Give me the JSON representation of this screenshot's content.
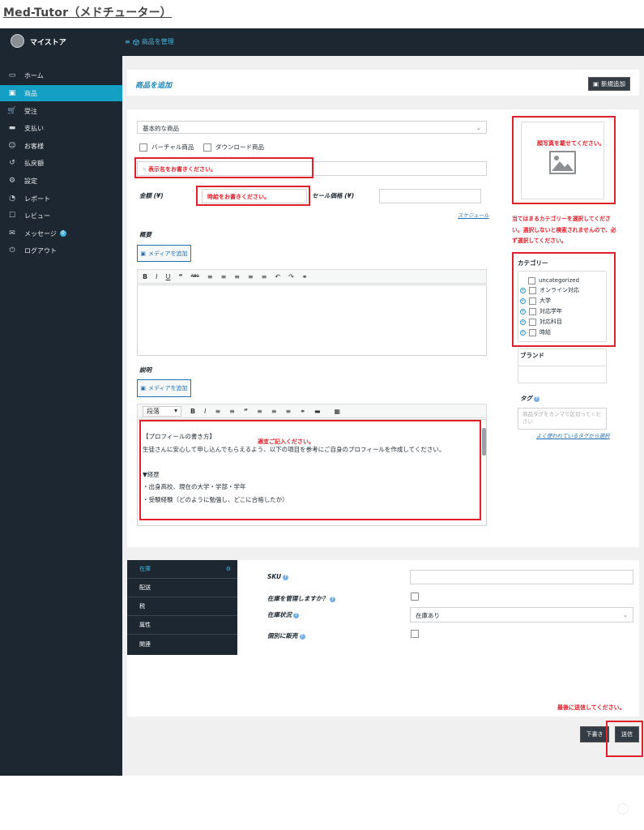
{
  "doc_title": "Med-Tutor（メドチューター）",
  "app": {
    "store_name": "マイストア",
    "breadcrumb": "商品を管理"
  },
  "sidebar": {
    "items": [
      {
        "label": "ホーム",
        "icon": "monitor-icon",
        "active": false
      },
      {
        "label": "商品",
        "icon": "box-icon",
        "active": true
      },
      {
        "label": "受注",
        "icon": "cart-icon",
        "active": false
      },
      {
        "label": "支払い",
        "icon": "card-icon",
        "active": false
      },
      {
        "label": "お客様",
        "icon": "user-icon",
        "active": false
      },
      {
        "label": "払戻額",
        "icon": "refund-icon",
        "active": false
      },
      {
        "label": "設定",
        "icon": "gear-icon",
        "active": false
      },
      {
        "label": "レポート",
        "icon": "chart-icon",
        "active": false
      },
      {
        "label": "レビュー",
        "icon": "comment-icon",
        "active": false
      },
      {
        "label": "メッセージ",
        "icon": "chat-icon",
        "active": false,
        "badge": "0"
      },
      {
        "label": "ログアウト",
        "icon": "power-icon",
        "active": false
      }
    ]
  },
  "header": {
    "title": "商品を追加",
    "new_button": "新規追加"
  },
  "form": {
    "product_type": "基本的な商品",
    "virtual_label": "バーチャル商品",
    "download_label": "ダウンロード商品",
    "name_placeholder": "表示名をお書きください。",
    "price_label": "金額 (¥)",
    "price_note": "時給をお書きください。",
    "sale_label": "セール価格 (¥)",
    "schedule_link": "スケジュール",
    "summary_label": "概要",
    "media_button": "メディアを追加",
    "description_label": "説明",
    "paragraph_select": "段落",
    "desc_note": "適宜ご記入ください。",
    "desc_lines": [
      "【プロフィールの書き方】",
      "生徒さんに安心して申し込んでもらえるよう、以下の項目を参考にご自身のプロフィールを作成してください。",
      "",
      "▼経歴",
      "・出身高校、現在の大学・学部・学年",
      "・受験経験（どのように勉強し、どこに合格したか）"
    ]
  },
  "image_box": {
    "note": "顔写真を載せてください。"
  },
  "category_note": "当てはまるカテゴリーを選択してください。選択しないと検索されませんので、必ず選択してください。",
  "categories": {
    "title": "カテゴリー",
    "items": [
      {
        "label": "uncategorized",
        "expandable": false
      },
      {
        "label": "オンライン対応",
        "expandable": true
      },
      {
        "label": "大学",
        "expandable": true
      },
      {
        "label": "対応学年",
        "expandable": true
      },
      {
        "label": "対応科目",
        "expandable": true
      },
      {
        "label": "時給",
        "expandable": true
      }
    ]
  },
  "brand": {
    "title": "ブランド"
  },
  "tags": {
    "title": "タグ",
    "placeholder": "商品タグをカンマで区切ってください",
    "link": "よく使われているタグから選択"
  },
  "inventory": {
    "tabs": [
      {
        "label": "在庫",
        "active": true
      },
      {
        "label": "配送",
        "active": false
      },
      {
        "label": "税",
        "active": false
      },
      {
        "label": "属性",
        "active": false
      },
      {
        "label": "関連",
        "active": false
      }
    ],
    "sku_label": "SKU",
    "manage_label": "在庫を管理しますか？",
    "status_label": "在庫状況",
    "status_value": "在庫あり",
    "sold_individually_label": "個別に販売"
  },
  "footer": {
    "submit_note": "最後に送信してください。",
    "draft_button": "下書き",
    "submit_button": "送信"
  },
  "colors": {
    "sidebar_bg": "#1d2731",
    "active_item": "#14a0c4",
    "annotation_red": "#e0202a",
    "link_blue": "#2271b1"
  }
}
